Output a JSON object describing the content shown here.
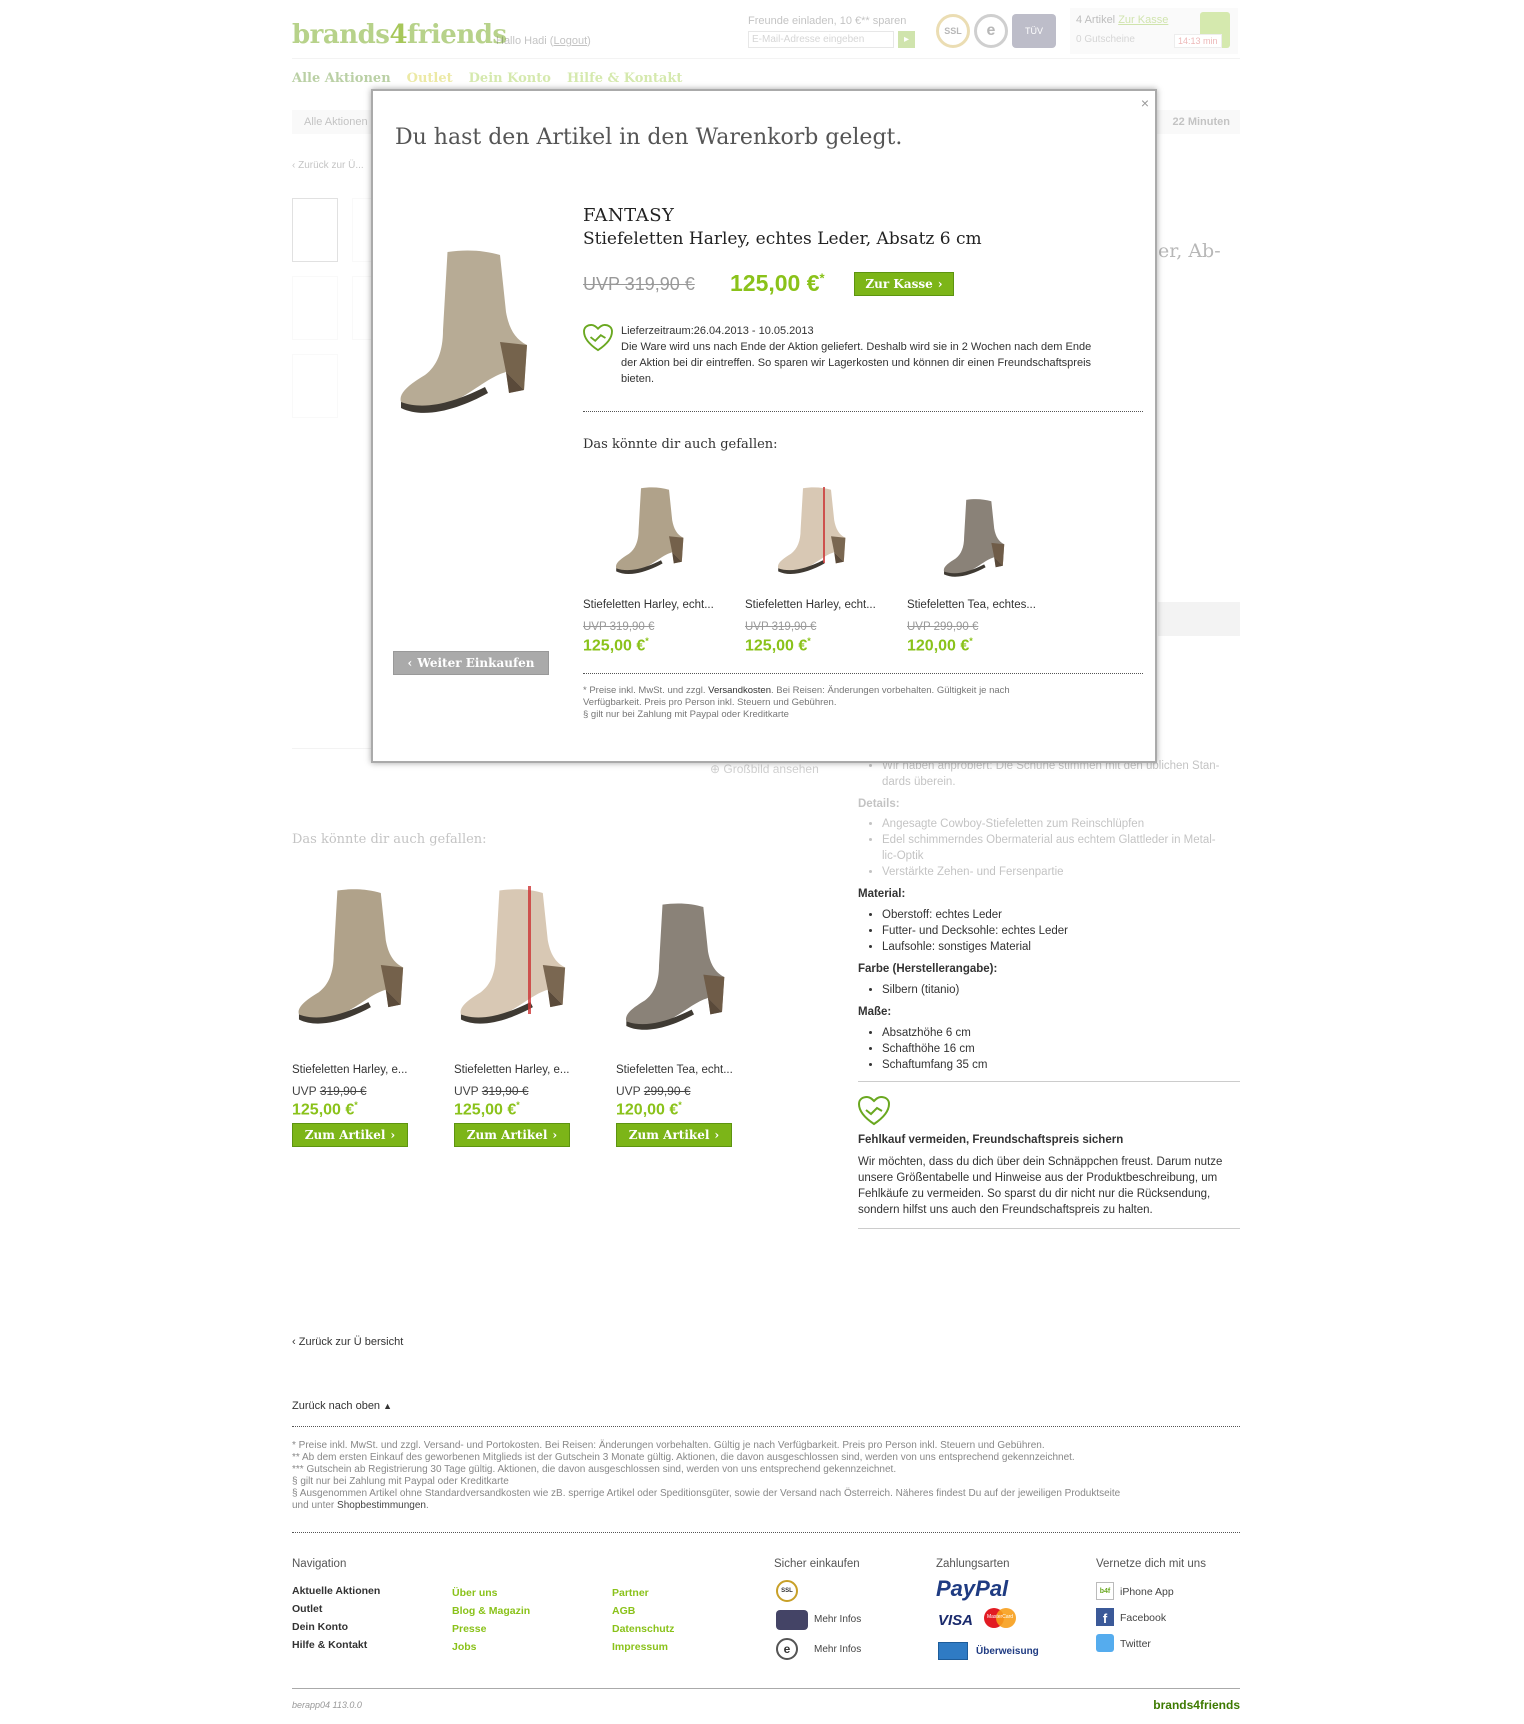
{
  "header": {
    "logo_a": "brands",
    "logo_b": "4",
    "logo_c": "friends",
    "greeting": "Hallo Hadi",
    "logout": "Logout",
    "invite_label": "Freunde einladen, 10 €** sparen",
    "invite_placeholder": "E-Mail-Adresse eingeben",
    "badges": [
      "SSL",
      "e",
      "TÜV"
    ],
    "cart_count": "4 Artikel",
    "cart_checkout": "Zur Kasse",
    "cart_vouchers": "0 Gutscheine",
    "cart_timer": "14:13 min"
  },
  "nav": [
    "Alle Aktionen",
    "Outlet",
    "Dein Konto",
    "Hilfe & Kontakt"
  ],
  "breadcrumb": {
    "first": "Alle Aktionen",
    "time_right": "22 Minuten"
  },
  "back_link": "Zurück zur Ü...",
  "bg_title_fragment": "er, Ab-",
  "zoom_link": "Großbild ansehen",
  "also_like_title": "Das könnte dir auch gefallen:",
  "products": [
    {
      "name": "Stiefeletten Harley, e...",
      "uvp_label": "UVP",
      "uvp": "319,90 €",
      "price": "125,00 €",
      "btn": "Zum Artikel"
    },
    {
      "name": "Stiefeletten Harley, e...",
      "uvp_label": "UVP",
      "uvp": "319,90 €",
      "price": "125,00 €",
      "btn": "Zum Artikel"
    },
    {
      "name": "Stiefeletten Tea, echt...",
      "uvp_label": "UVP",
      "uvp": "299,90 €",
      "price": "120,00 €",
      "btn": "Zum Artikel"
    }
  ],
  "details": {
    "fit_text": "Wir haben anprobiert: Die Schuhe stimmen mit den üblichen Standards überein.",
    "fit_l1": "Wir haben anprobiert: Die Schuhe stimmen mit den üblichen Stan-",
    "fit_l2": "dards überein.",
    "details_h": "Details:",
    "details_items": [
      "Angesagte Cowboy-Stiefeletten zum Reinschlüpfen",
      "Edel schimmerndes Obermaterial aus echtem Glattleder in Metal-",
      "lic-Optik",
      "Verstärkte Zehen- und Fersenpartie"
    ],
    "material_h": "Material:",
    "material_items": [
      "Oberstoff: echtes Leder",
      "Futter- und Decksohle: echtes Leder",
      "Laufsohle: sonstiges Material"
    ],
    "farbe_h": "Farbe (Herstellerangabe):",
    "farbe_items": [
      "Silbern (titanio)"
    ],
    "masse_h": "Maße:",
    "masse_items": [
      "Absatzhöhe 6 cm",
      "Schafthöhe 16 cm",
      "Schaftumfang 35 cm"
    ],
    "friend_h": "Fehlkauf vermeiden, Freundschaftspreis sichern",
    "friend_l1": "Wir möchten, dass du dich über dein Schnäppchen freust. Darum nutze",
    "friend_l2": "unsere Größentabelle und Hinweise aus der Produktbeschreibung, um",
    "friend_l3": "Fehlkäufe zu vermeiden. So sparst du dir nicht nur die Rücksendung,",
    "friend_l4": "sondern hilfst uns auch den Freundschaftspreis zu halten."
  },
  "back_overview": "Zurück zur Ü bersicht",
  "back_top": "Zurück nach oben",
  "footnotes": [
    "* Preise inkl. MwSt. und zzgl. Versand- und Portokosten. Bei Reisen: Änderungen vorbehalten. Gültig je nach Verfügbarkeit. Preis pro Person inkl. Steuern und Gebühren.",
    "** Ab dem ersten Einkauf des geworbenen Mitglieds ist der Gutschein 3 Monate gültig. Aktionen, die davon ausgeschlossen sind, werden von uns entsprechend gekennzeichnet.",
    "*** Gutschein ab Registrierung 30 Tage gültig. Aktionen, die davon ausgeschlossen sind, werden von uns entsprechend gekennzeichnet.",
    "§ gilt nur bei Zahlung mit Paypal oder Kreditkarte",
    "§ Ausgenommen Artikel ohne Standardversandkosten wie zB. sperrige Artikel oder Speditionsgüter, sowie der Versand nach Österreich. Näheres findest Du auf der jeweiligen Produktseite"
  ],
  "footnote_tail": "und unter",
  "footnote_link": "Shopbestimmungen",
  "footer": {
    "nav_h": "Navigation",
    "col1": [
      "Aktuelle Aktionen",
      "Outlet",
      "Dein Konto",
      "Hilfe & Kontakt"
    ],
    "col2": [
      "Über uns",
      "Blog & Magazin",
      "Presse",
      "Jobs"
    ],
    "col3": [
      "Partner",
      "AGB",
      "Datenschutz",
      "Impressum"
    ],
    "secure_h": "Sicher einkaufen",
    "more_info": "Mehr Infos",
    "pay_h": "Zahlungsarten",
    "paypal": "PayPal",
    "visa": "VISA",
    "mastercard": "MasterCard",
    "transfer": "Überweisung",
    "social_h": "Vernetze dich mit uns",
    "social": [
      "iPhone App",
      "Facebook",
      "Twitter"
    ],
    "version": "berapp04 113.0.0",
    "logo": "brands4friends"
  },
  "modal": {
    "title": "Du hast den Artikel in den Warenkorb gelegt.",
    "close": "×",
    "brand": "FANTASY",
    "product": "Stiefeletten Harley, echtes Leder, Absatz 6 cm",
    "uvp": "UVP 319,90 €",
    "price": "125,00 €",
    "price_sup": "*",
    "checkout_btn": "Zur Kasse",
    "delivery": "Lieferzeitraum:26.04.2013 - 10.05.2013",
    "delivery_text_1": "Die Ware wird uns nach Ende der Aktion geliefert. Deshalb wird sie in 2 Wochen nach dem Ende",
    "delivery_text_2": "der Aktion bei dir eintreffen. So sparen wir Lagerkosten und können dir einen Freundschaftspreis",
    "delivery_text_3": "bieten.",
    "also_like": "Das könnte dir auch gefallen:",
    "items": [
      {
        "name": "Stiefeletten Harley, echt...",
        "uvp": "UVP 319,90 €",
        "price": "125,00 €"
      },
      {
        "name": "Stiefeletten Harley, echt...",
        "uvp": "UVP 319,90 €",
        "price": "125,00 €"
      },
      {
        "name": "Stiefeletten Tea, echtes...",
        "uvp": "UVP 299,90 €",
        "price": "120,00 €"
      }
    ],
    "continue_btn": "Weiter Einkaufen",
    "fn1_pre": "* Preise inkl. MwSt. und zzgl.",
    "fn1_link": "Versandkosten",
    "fn1_post": ". Bei Reisen: Änderungen vorbehalten. Gültigkeit je nach",
    "fn2": "Verfügbarkeit. Preis pro Person inkl. Steuern und Gebühren.",
    "fn3": "§ gilt nur bei Zahlung mit Paypal oder Kreditkarte"
  },
  "colors": {
    "accent": "#8ac21a",
    "button": "#7cb518"
  }
}
